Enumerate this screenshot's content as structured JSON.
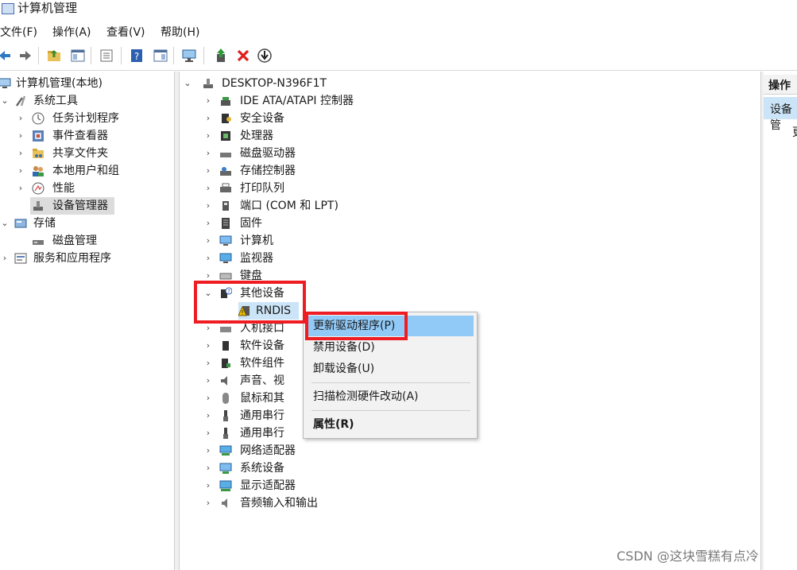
{
  "window": {
    "title": "计算机管理"
  },
  "menu": [
    "文件(F)",
    "操作(A)",
    "查看(V)",
    "帮助(H)"
  ],
  "left_tree": {
    "root": "计算机管理(本地)",
    "system_tools": "系统工具",
    "task_scheduler": "任务计划程序",
    "event_viewer": "事件查看器",
    "shared_folders": "共享文件夹",
    "local_users": "本地用户和组",
    "performance": "性能",
    "device_manager": "设备管理器",
    "storage": "存储",
    "disk_management": "磁盘管理",
    "services": "服务和应用程序"
  },
  "device_tree": {
    "computer": "DESKTOP-N396F1T",
    "categories": [
      "IDE ATA/ATAPI 控制器",
      "安全设备",
      "处理器",
      "磁盘驱动器",
      "存储控制器",
      "打印队列",
      "端口 (COM 和 LPT)",
      "固件",
      "计算机",
      "监视器",
      "键盘",
      "其他设备",
      "RNDIS",
      "人机接口",
      "软件设备",
      "软件组件",
      "声音、视",
      "鼠标和其",
      "通用串行",
      "通用串行",
      "网络适配器",
      "系统设备",
      "显示适配器",
      "音频输入和输出"
    ]
  },
  "right_panel": {
    "header": "操作",
    "selected": "设备管",
    "sub": "更"
  },
  "context_menu": {
    "update_driver": "更新驱动程序(P)",
    "disable": "禁用设备(D)",
    "uninstall": "卸载设备(U)",
    "scan": "扫描检测硬件改动(A)",
    "properties": "属性(R)"
  },
  "watermark": "CSDN @这块雪糕有点冷",
  "colors": {
    "highlight": "#91c9f7",
    "annotation_red": "#ee1d23",
    "right_selected": "#cce4f7"
  }
}
